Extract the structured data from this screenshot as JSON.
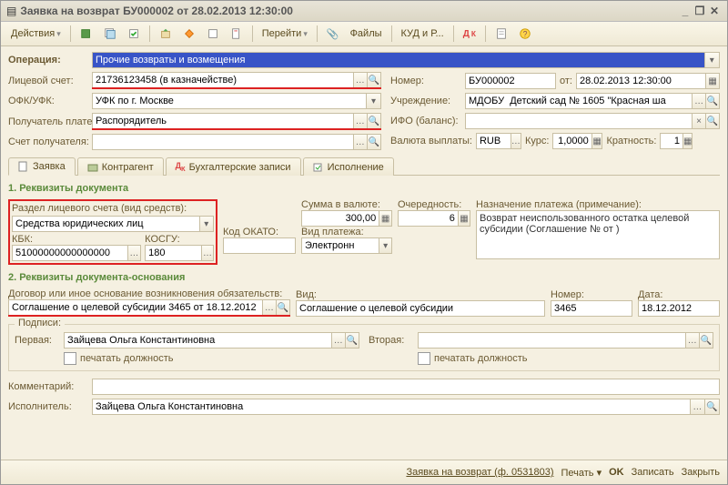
{
  "window": {
    "title": "Заявка на возврат БУ000002 от 28.02.2013 12:30:00"
  },
  "toolbar": {
    "actions": "Действия",
    "go": "Перейти",
    "files": "Файлы",
    "kud": "КУД и Р..."
  },
  "operation": {
    "label": "Операция:",
    "value": "Прочие возвраты и возмещения"
  },
  "account": {
    "label": "Лицевой счет:",
    "value": "21736123458 (в казначействе)"
  },
  "ofk": {
    "label": "ОФК/УФК:",
    "value": "УФК по г. Москве"
  },
  "recipient": {
    "label": "Получатель платежа:",
    "value": "Распорядитель"
  },
  "recip_acc": {
    "label": "Счет получателя:",
    "value": ""
  },
  "number": {
    "label": "Номер:",
    "value": "БУ000002",
    "from": "от:"
  },
  "date": {
    "value": "28.02.2013 12:30:00"
  },
  "org": {
    "label": "Учреждение:",
    "value": "МДОБУ  Детский сад № 1605 \"Красная ша"
  },
  "ifo": {
    "label": "ИФО (баланс):",
    "value": ""
  },
  "currency": {
    "label": "Валюта выплаты:",
    "value": "RUB",
    "rate_label": "Курс:",
    "rate": "1,0000",
    "mult_label": "Кратность:",
    "mult": "1"
  },
  "tabs": {
    "t1": "Заявка",
    "t2": "Контрагент",
    "t3": "Бухгалтерские записи",
    "t4": "Исполнение"
  },
  "sec1": {
    "title": "1. Реквизиты документа"
  },
  "section": {
    "label": "Раздел лицевого счета (вид средств):",
    "value": "Средства юридических лиц"
  },
  "sum": {
    "label": "Сумма в валюте:",
    "value": "300,00"
  },
  "priority": {
    "label": "Очередность:",
    "value": "6"
  },
  "purpose": {
    "label": "Назначение платежа (примечание):",
    "value": "Возврат неиспользованного остатка целевой субсидии (Соглашение №  от  )"
  },
  "kbk": {
    "label": "КБК:",
    "value": "51000000000000000"
  },
  "kosgu": {
    "label": "КОСГУ:",
    "value": "180"
  },
  "okato": {
    "label": "Код ОКАТО:",
    "value": ""
  },
  "paytype": {
    "label": "Вид платежа:",
    "value": "Электронн"
  },
  "sec2": {
    "title": "2. Реквизиты документа-основания"
  },
  "contract": {
    "label": "Договор или иное основание возникновения обязательств:",
    "value": "Соглашение о целевой субсидии 3465 от 18.12.2012"
  },
  "doctype": {
    "label": "Вид:",
    "value": "Соглашение о целевой субсидии"
  },
  "docnum": {
    "label": "Номер:",
    "value": "3465"
  },
  "docdate": {
    "label": "Дата:",
    "value": "18.12.2012"
  },
  "sign": {
    "title": "Подписи:",
    "first": "Первая:",
    "first_val": "Зайцева Ольга Константиновна",
    "second": "Вторая:",
    "second_val": "",
    "print": "печатать должность"
  },
  "comment": {
    "label": "Комментарий:",
    "value": ""
  },
  "executor": {
    "label": "Исполнитель:",
    "value": "Зайцева Ольга Константиновна"
  },
  "bottom": {
    "form": "Заявка на возврат (ф. 0531803)",
    "print": "Печать",
    "ok": "OK",
    "save": "Записать",
    "close": "Закрыть"
  }
}
